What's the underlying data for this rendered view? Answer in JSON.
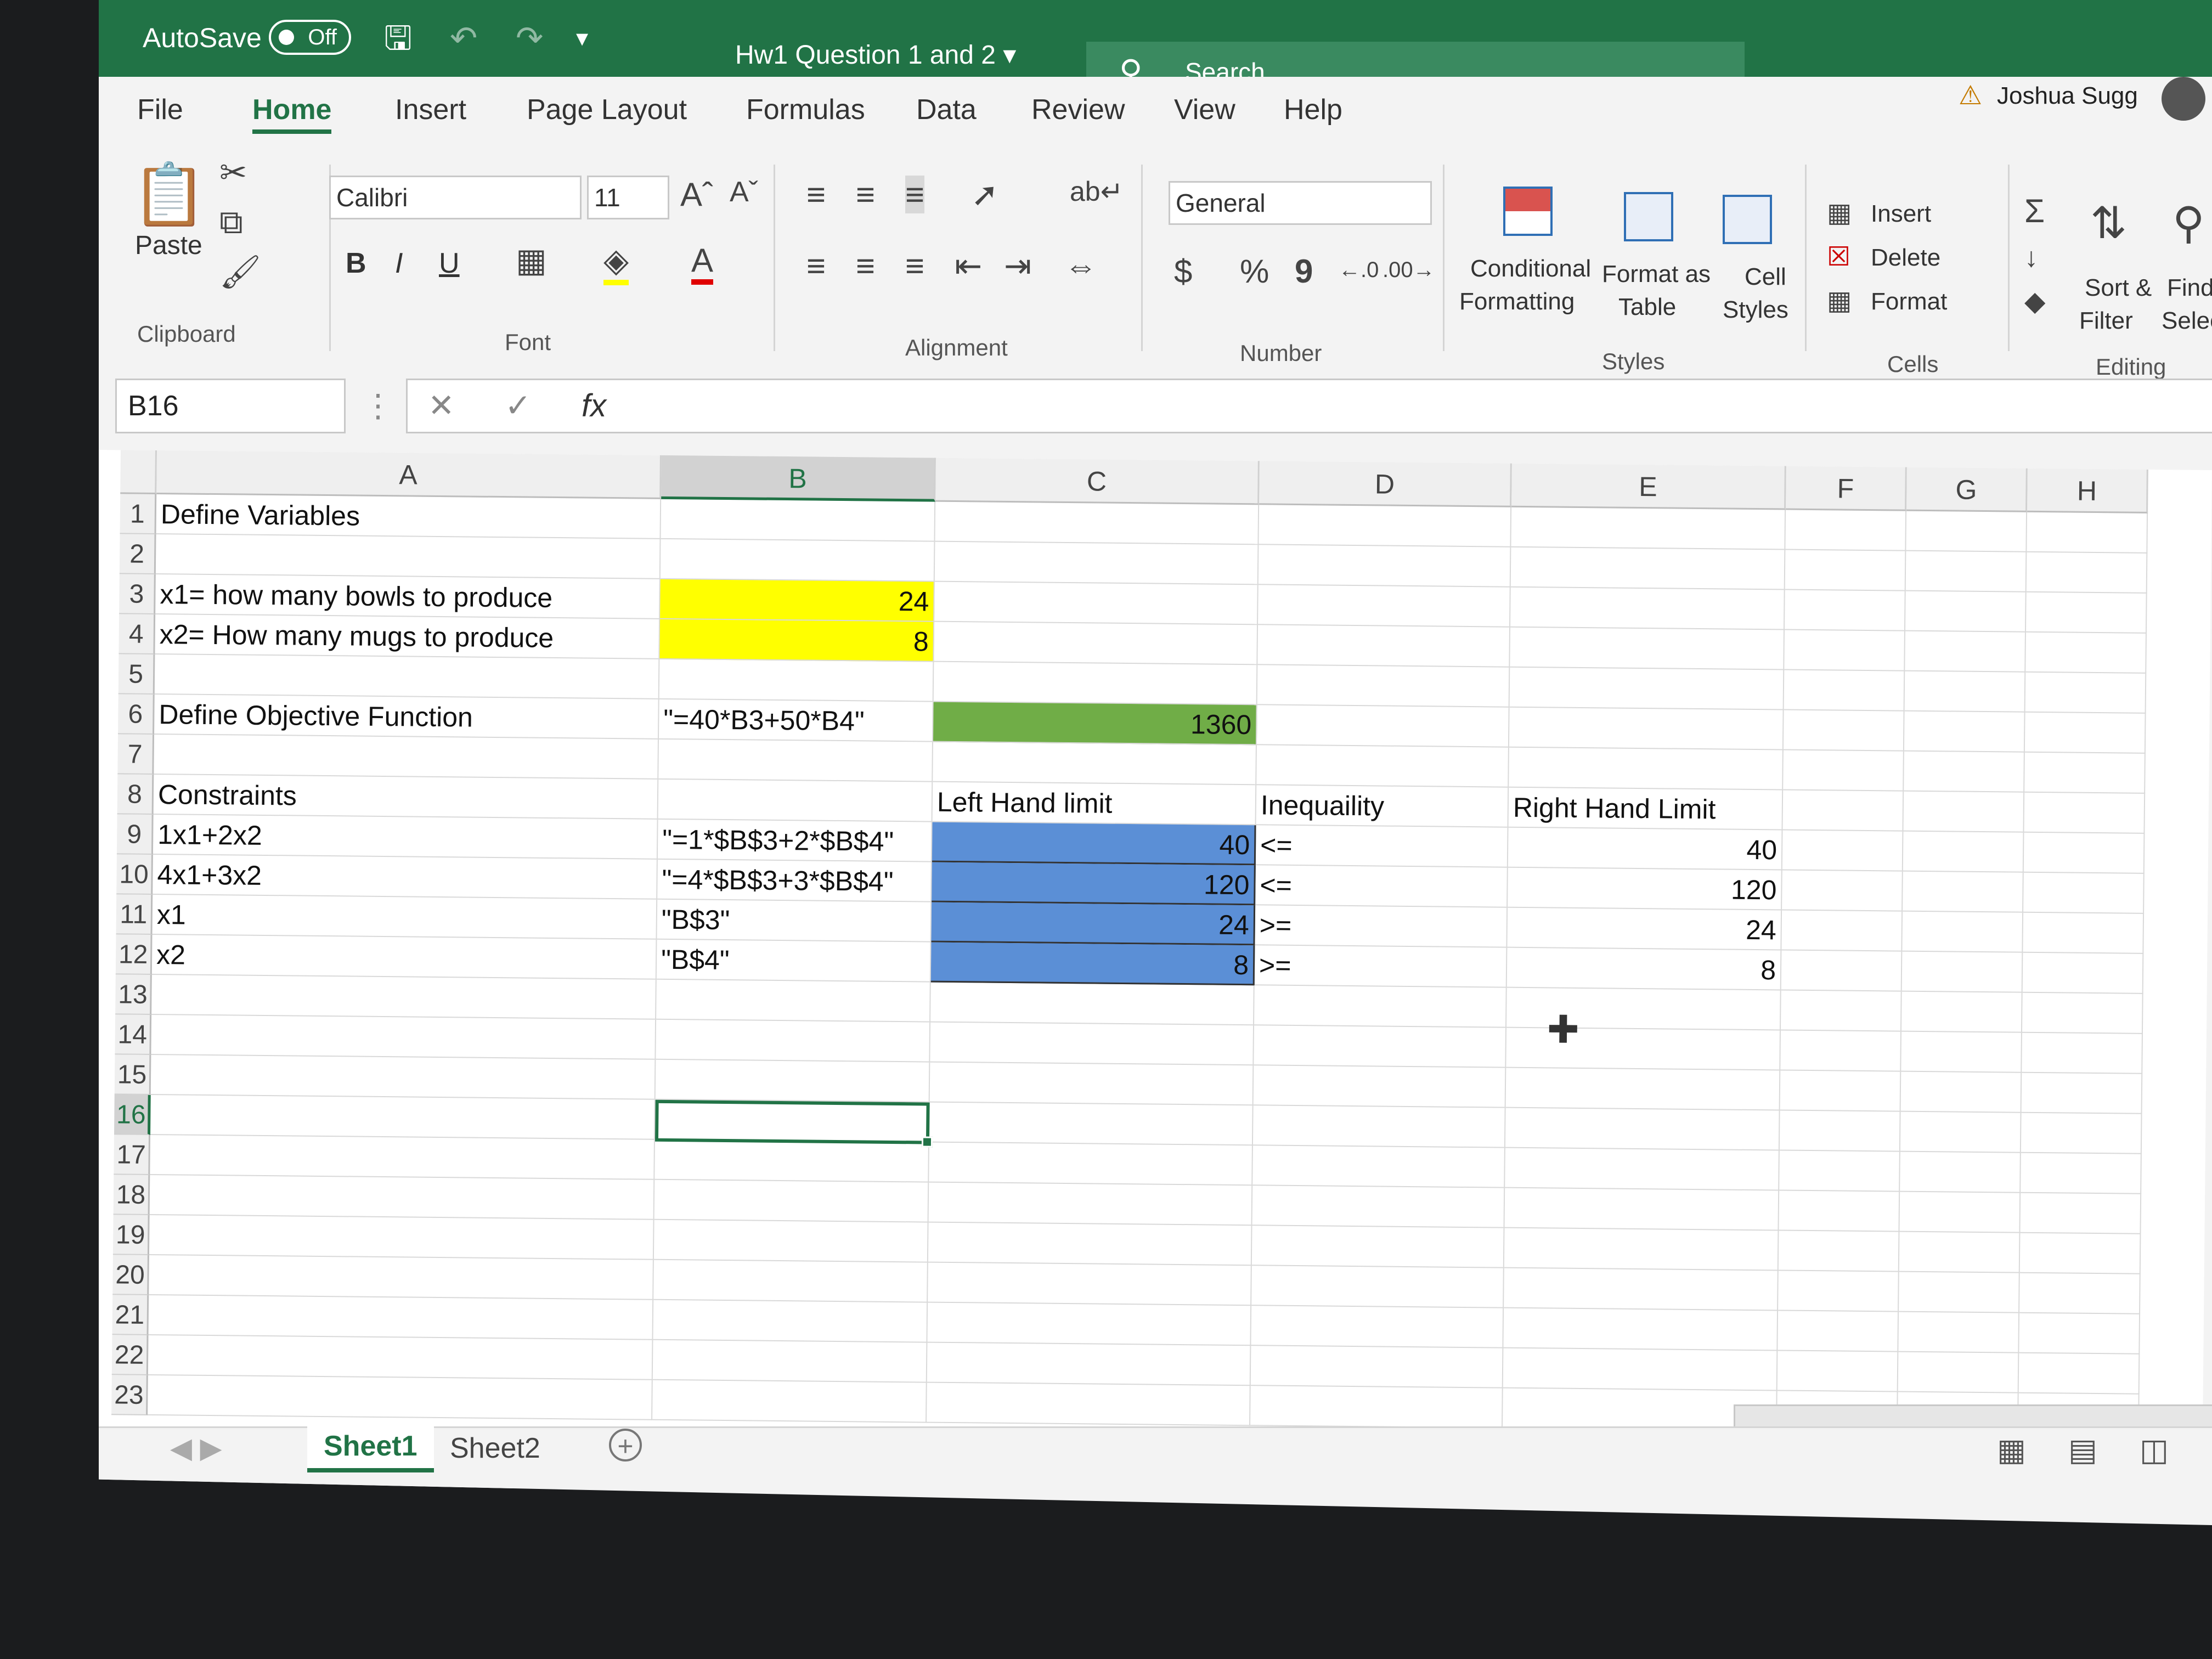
{
  "titlebar": {
    "autosave_label": "AutoSave",
    "autosave_state": "Off",
    "document_title": "Hw1 Question 1 and 2",
    "search_placeholder": "Search",
    "user_name": "Joshua Sugg"
  },
  "tabs": [
    "File",
    "Home",
    "Insert",
    "Page Layout",
    "Formulas",
    "Data",
    "Review",
    "View",
    "Help"
  ],
  "ribbon": {
    "clipboard": {
      "paste": "Paste",
      "group": "Clipboard"
    },
    "font": {
      "name": "Calibri",
      "size": "11",
      "bold": "B",
      "italic": "I",
      "underline": "U",
      "group": "Font"
    },
    "alignment": {
      "group": "Alignment"
    },
    "number": {
      "format": "General",
      "currency": "$",
      "percent": "%",
      "comma": "9",
      "group": "Number"
    },
    "styles": {
      "conditional_1": "Conditional",
      "conditional_2": "Formatting",
      "format_table_1": "Format as",
      "format_table_2": "Table",
      "cell_styles_1": "Cell",
      "cell_styles_2": "Styles",
      "group": "Styles"
    },
    "cells": {
      "insert": "Insert",
      "delete": "Delete",
      "format": "Format",
      "group": "Cells"
    },
    "editing": {
      "sort_1": "Sort &",
      "sort_2": "Filter",
      "find_1": "Find",
      "find_2": "Selec",
      "group": "Editing"
    }
  },
  "formula_bar": {
    "name_box": "B16",
    "fx": "fx"
  },
  "columns": [
    "A",
    "B",
    "C",
    "D",
    "E",
    "F",
    "G",
    "H"
  ],
  "rows": [
    "1",
    "2",
    "3",
    "4",
    "5",
    "6",
    "7",
    "8",
    "9",
    "10",
    "11",
    "12",
    "13",
    "14",
    "15",
    "16",
    "17",
    "18",
    "19",
    "20",
    "21",
    "22",
    "23"
  ],
  "cells": {
    "A1": "Define Variables",
    "A3": "x1= how many bowls to produce",
    "B3": "24",
    "A4": "x2= How many mugs to produce",
    "B4": "8",
    "A6": "Define Objective Function",
    "B6": "\"=40*B3+50*B4\"",
    "C6": "1360",
    "A8": "Constraints",
    "C8": "Left Hand limit",
    "D8": "Inequaility",
    "E8": "Right Hand Limit",
    "A9": "1x1+2x2",
    "B9": "\"=1*$B$3+2*$B$4\"",
    "C9": "40",
    "D9": "<=",
    "E9": "40",
    "A10": "4x1+3x2",
    "B10": "\"=4*$B$3+3*$B$4\"",
    "C10": "120",
    "D10": "<=",
    "E10": "120",
    "A11": "x1",
    "B11": "\"B$3\"",
    "C11": "24",
    "D11": ">=",
    "E11": "24",
    "A12": "x2",
    "B12": "\"B$4\"",
    "C12": "8",
    "D12": ">=",
    "E12": "8"
  },
  "sheets": [
    "Sheet1",
    "Sheet2"
  ],
  "colors": {
    "excel_green": "#217346",
    "yellow_fill": "#ffff00",
    "green_fill": "#70ad47",
    "blue_fill": "#5b8fd6"
  }
}
